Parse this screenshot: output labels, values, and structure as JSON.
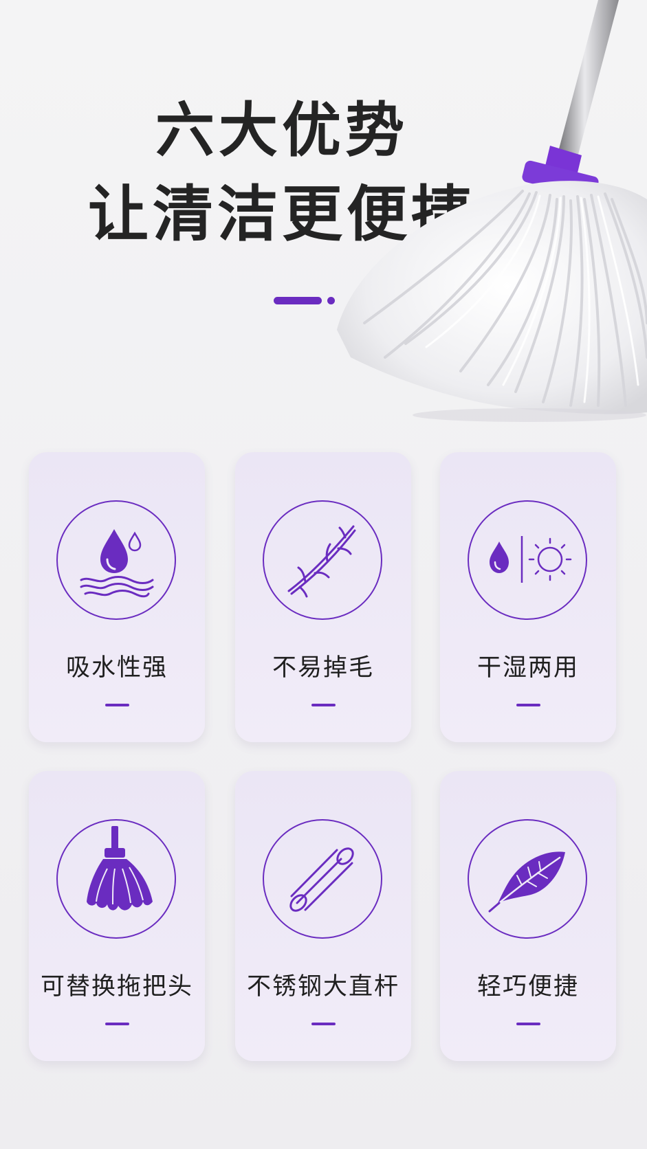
{
  "hero": {
    "title_line_1": "六大优势",
    "title_line_2": "让清洁更便捷"
  },
  "features": [
    {
      "label": "吸水性强",
      "icon": "water-absorption-icon"
    },
    {
      "label": "不易掉毛",
      "icon": "no-shedding-fiber-icon"
    },
    {
      "label": "干湿两用",
      "icon": "wet-dry-use-icon"
    },
    {
      "label": "可替换拖把头",
      "icon": "mop-head-icon"
    },
    {
      "label": "不锈钢大直杆",
      "icon": "steel-pole-icon"
    },
    {
      "label": "轻巧便捷",
      "icon": "feather-icon"
    }
  ],
  "colors": {
    "accent": "#6a2cc0",
    "card_background": "#efeaf7",
    "page_background": "#f2f1f3",
    "title_text": "#242424"
  }
}
